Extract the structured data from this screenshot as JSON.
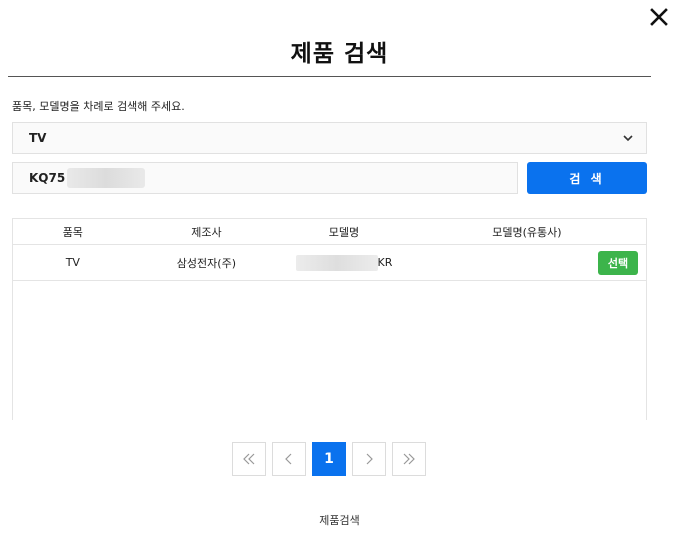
{
  "dialog": {
    "title": "제품 검색",
    "instruction": "품목, 모델명을 차례로 검색해 주세요."
  },
  "category_select": {
    "selected": "TV",
    "icon": "chevron-down-icon"
  },
  "search": {
    "value": "KQ75",
    "button_label": "검 색"
  },
  "table": {
    "headers": [
      "품목",
      "제조사",
      "모델명",
      "모델명(유통사)"
    ],
    "rows": [
      {
        "item": "TV",
        "maker": "삼성전자(주)",
        "model_suffix": "KR",
        "select_label": "선택"
      }
    ]
  },
  "pagination": {
    "current_page": "1"
  },
  "footer": {
    "label": "제품검색"
  },
  "colors": {
    "primary": "#0a72ee",
    "select_button": "#3cb44b"
  }
}
